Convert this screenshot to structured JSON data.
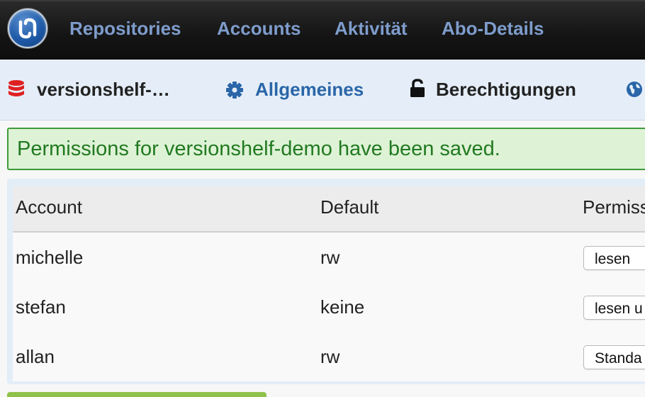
{
  "nav": {
    "items": [
      {
        "label": "Repositories"
      },
      {
        "label": "Accounts"
      },
      {
        "label": "Aktivität"
      },
      {
        "label": "Abo-Details"
      }
    ]
  },
  "subnav": {
    "repo_name": "versionshelf-…",
    "tabs": [
      {
        "label": "Allgemeines",
        "icon": "gear-icon"
      },
      {
        "label": "Berechtigungen",
        "icon": "unlock-icon"
      }
    ]
  },
  "alert": {
    "message": "Permissions for versionshelf-demo have been saved."
  },
  "table": {
    "headers": [
      "Account",
      "Default",
      "Permiss"
    ],
    "rows": [
      {
        "account": "michelle",
        "default": "rw",
        "permission": "lesen"
      },
      {
        "account": "stefan",
        "default": "keine",
        "permission": "lesen u"
      },
      {
        "account": "allan",
        "default": "rw",
        "permission": "Standa"
      }
    ]
  },
  "colors": {
    "nav_link": "#7e9ccc",
    "tab_link": "#2a66a8",
    "alert_text": "#217a21",
    "repo_icon": "#e02020"
  }
}
